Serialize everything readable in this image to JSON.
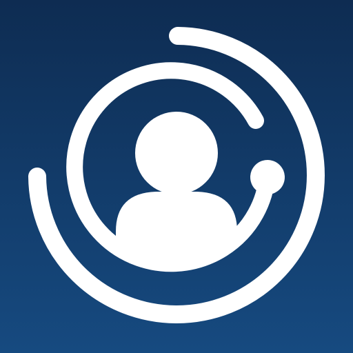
{
  "app_icon": {
    "icon": "user-profile-orbit-icon",
    "parts": [
      "outer-orbit-arc-icon",
      "inner-orbit-ring-icon",
      "avatar-head-icon",
      "avatar-body-icon",
      "orbit-dot-icon"
    ]
  },
  "colors": {
    "background_top": "#0e2c52",
    "background_bottom": "#164a80",
    "foreground": "#ffffff"
  }
}
